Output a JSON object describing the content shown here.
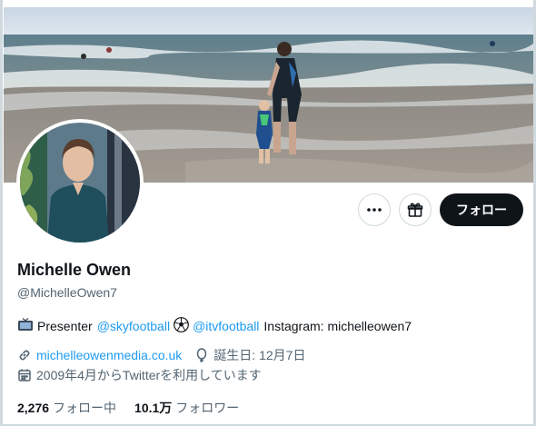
{
  "profile": {
    "name": "Michelle Owen",
    "handle": "@MichelleOwen7"
  },
  "actions": {
    "more_icon": "more-horizontal-icon",
    "gift_icon": "gift-icon",
    "follow_label": "フォロー"
  },
  "bio": {
    "prefix": "Presenter",
    "link1": "@skyfootball",
    "link2": "@itvfootball",
    "suffix": "Instagram: michelleowen7"
  },
  "meta": {
    "website": "michelleowenmedia.co.uk",
    "birthday": "誕生日: 12月7日",
    "joined": "2009年4月からTwitterを利用しています"
  },
  "stats": {
    "following_count": "2,276",
    "following_label": "フォロー中",
    "followers_count": "10.1万",
    "followers_label": "フォロワー"
  },
  "colors": {
    "accent": "#1d9bf0",
    "follow_bg": "#0f1419",
    "muted": "#536471"
  }
}
